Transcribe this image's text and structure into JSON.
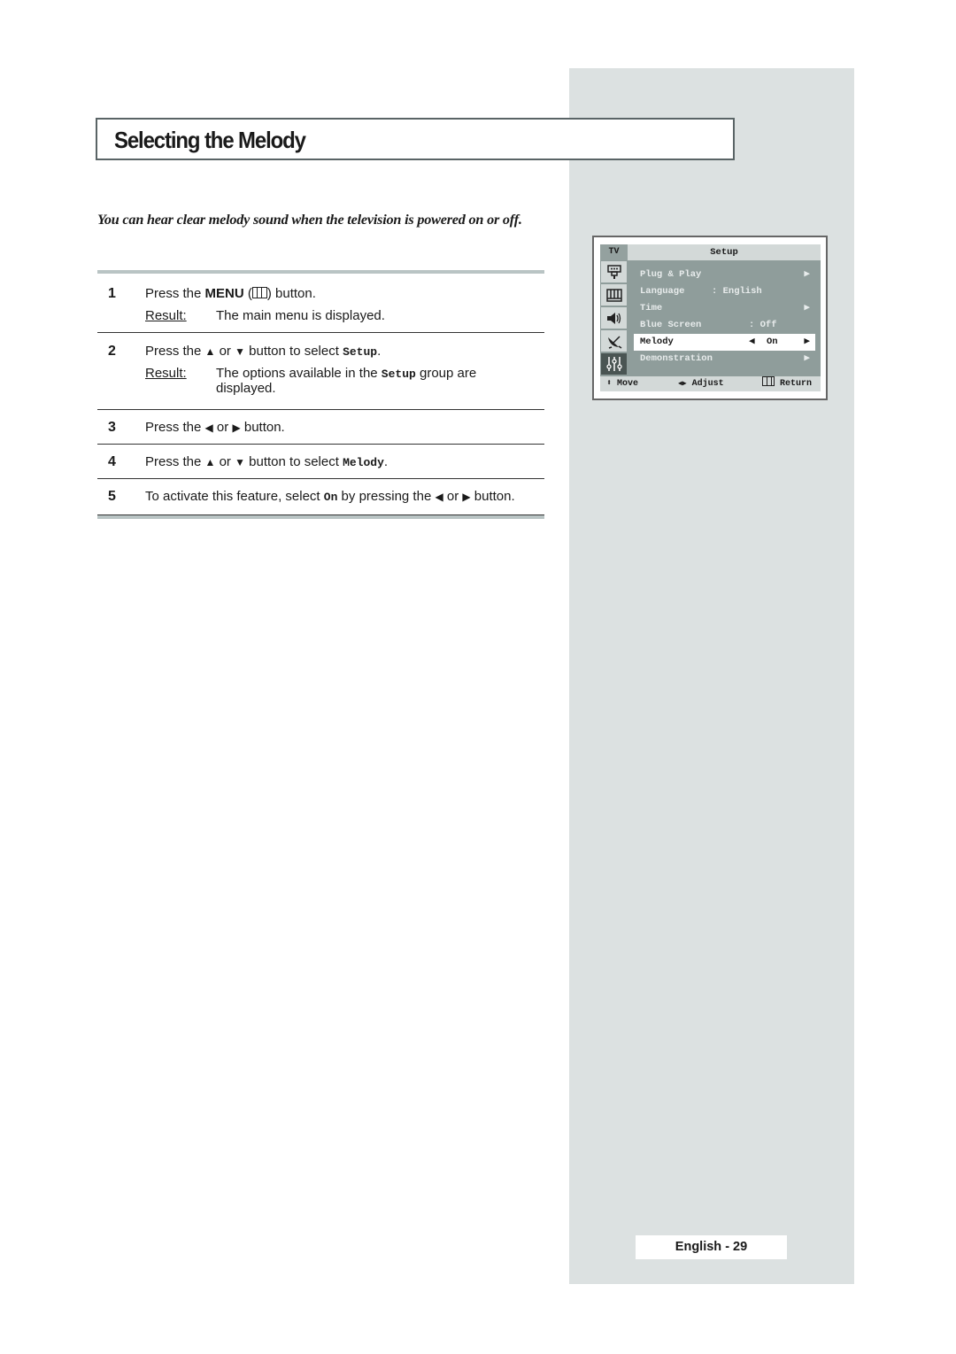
{
  "page": {
    "title": "Selecting the Melody",
    "intro": "You can hear clear melody sound when the television is powered on or off.",
    "page_label": "English - 29"
  },
  "steps": [
    {
      "num": "1",
      "parts": {
        "a": "Press the ",
        "b": "MENU",
        "c": " (",
        "d": ") button."
      },
      "result_label": "Result:",
      "result": "The main menu is displayed."
    },
    {
      "num": "2",
      "parts": {
        "a": "Press the ",
        "up": "▲",
        "b": " or ",
        "down": "▼",
        "c": " button to select ",
        "code": "Setup",
        "d": "."
      },
      "result_label": "Result:",
      "result": {
        "a": "The options available in the ",
        "code": "Setup",
        "b": " group are displayed."
      }
    },
    {
      "num": "3",
      "parts": {
        "a": "Press the ",
        "left": "◀",
        "b": " or ",
        "right": "▶",
        "c": " button."
      }
    },
    {
      "num": "4",
      "parts": {
        "a": "Press the ",
        "up": "▲",
        "b": " or ",
        "down": "▼",
        "c": " button to select ",
        "code": "Melody",
        "d": "."
      }
    },
    {
      "num": "5",
      "parts": {
        "a": "To activate this feature, select ",
        "code": "On",
        "b": " by pressing the ",
        "left": "◀",
        "c": " or ",
        "right": "▶",
        "d": " button."
      }
    }
  ],
  "osd": {
    "source_label": "TV",
    "title": "Setup",
    "side_icons": [
      "input-icon",
      "picture-icon",
      "sound-icon",
      "channel-icon",
      "setup-icon"
    ],
    "items": [
      {
        "label": "Plug & Play",
        "value": "",
        "arrow": "▶"
      },
      {
        "label": "Language",
        "value": ": English",
        "arrow": ""
      },
      {
        "label": "Time",
        "value": "",
        "arrow": "▶"
      },
      {
        "label": "Blue Screen",
        "value": ": Off",
        "arrow": ""
      },
      {
        "label": "Melody",
        "value": "On",
        "left_arrow": "◀",
        "arrow": "▶",
        "selected": true
      },
      {
        "label": "Demonstration",
        "value": "",
        "arrow": "▶"
      }
    ],
    "footer": {
      "move": "Move",
      "move_icon": "⬍",
      "adjust": "Adjust",
      "adjust_icon": "◀▶",
      "return": "Return"
    }
  },
  "colors": {
    "side_column": "#dce1e1",
    "osd_body": "#8f9d9b",
    "osd_header": "#d3d9d8",
    "osd_active_icon": "#4a5553"
  }
}
